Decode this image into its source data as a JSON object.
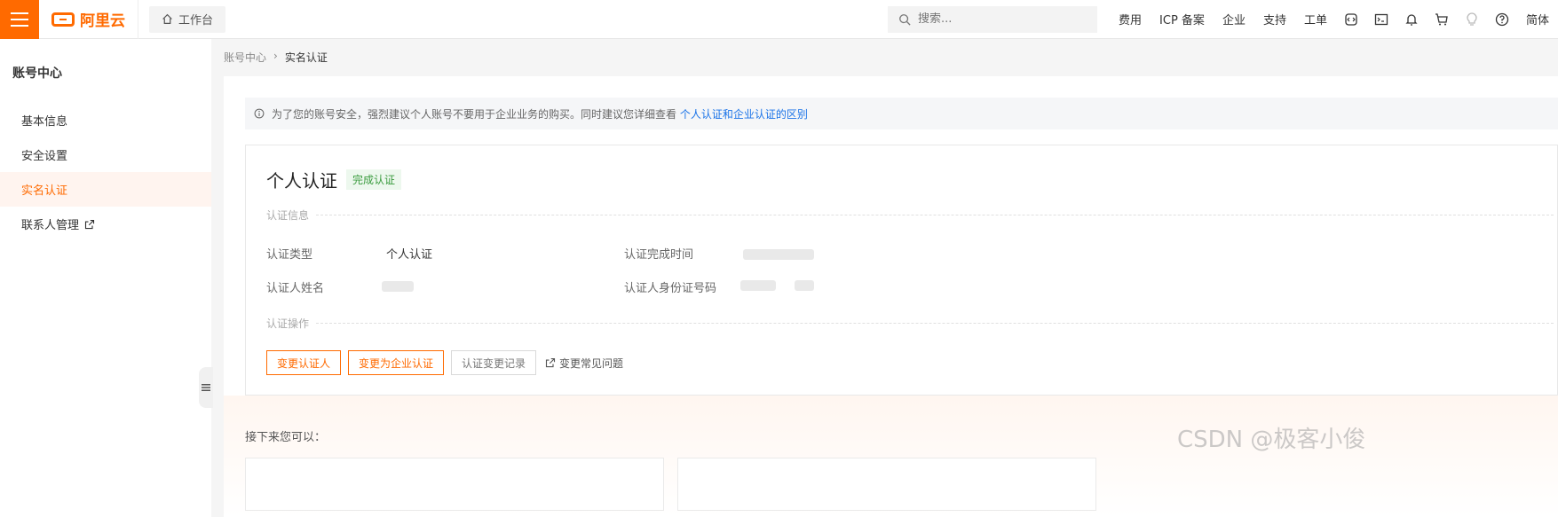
{
  "topbar": {
    "logo_text": "阿里云",
    "workbench_label": "工作台",
    "search_placeholder": "搜索...",
    "links": [
      "费用",
      "ICP 备案",
      "企业",
      "支持",
      "工单"
    ],
    "icons": [
      "code-icon",
      "terminal-icon",
      "bell-icon",
      "cart-icon",
      "bulb-icon",
      "help-icon"
    ],
    "lang_label": "简体"
  },
  "sidebar": {
    "title": "账号中心",
    "items": [
      {
        "label": "基本信息"
      },
      {
        "label": "安全设置"
      },
      {
        "label": "实名认证"
      },
      {
        "label": "联系人管理"
      }
    ]
  },
  "breadcrumb": {
    "parent": "账号中心",
    "separator": "›",
    "current": "实名认证"
  },
  "notice": {
    "text": "为了您的账号安全，强烈建议个人账号不要用于企业业务的购买。同时建议您详细查看",
    "link": "个人认证和企业认证的区别"
  },
  "auth": {
    "title": "个人认证",
    "status": "完成认证",
    "info_section": "认证信息",
    "type_label": "认证类型",
    "type_value": "个人认证",
    "time_label": "认证完成时间",
    "name_label": "认证人姓名",
    "id_label": "认证人身份证号码",
    "ops_section": "认证操作",
    "btn_change_person": "变更认证人",
    "btn_change_enterprise": "变更为企业认证",
    "btn_history": "认证变更记录",
    "faq_link": "变更常见问题"
  },
  "next": {
    "title": "接下来您可以："
  },
  "watermark": "CSDN @极客小俊",
  "colors": {
    "accent": "#ff6a00",
    "link": "#1a73e8",
    "success": "#3a9b3e"
  }
}
